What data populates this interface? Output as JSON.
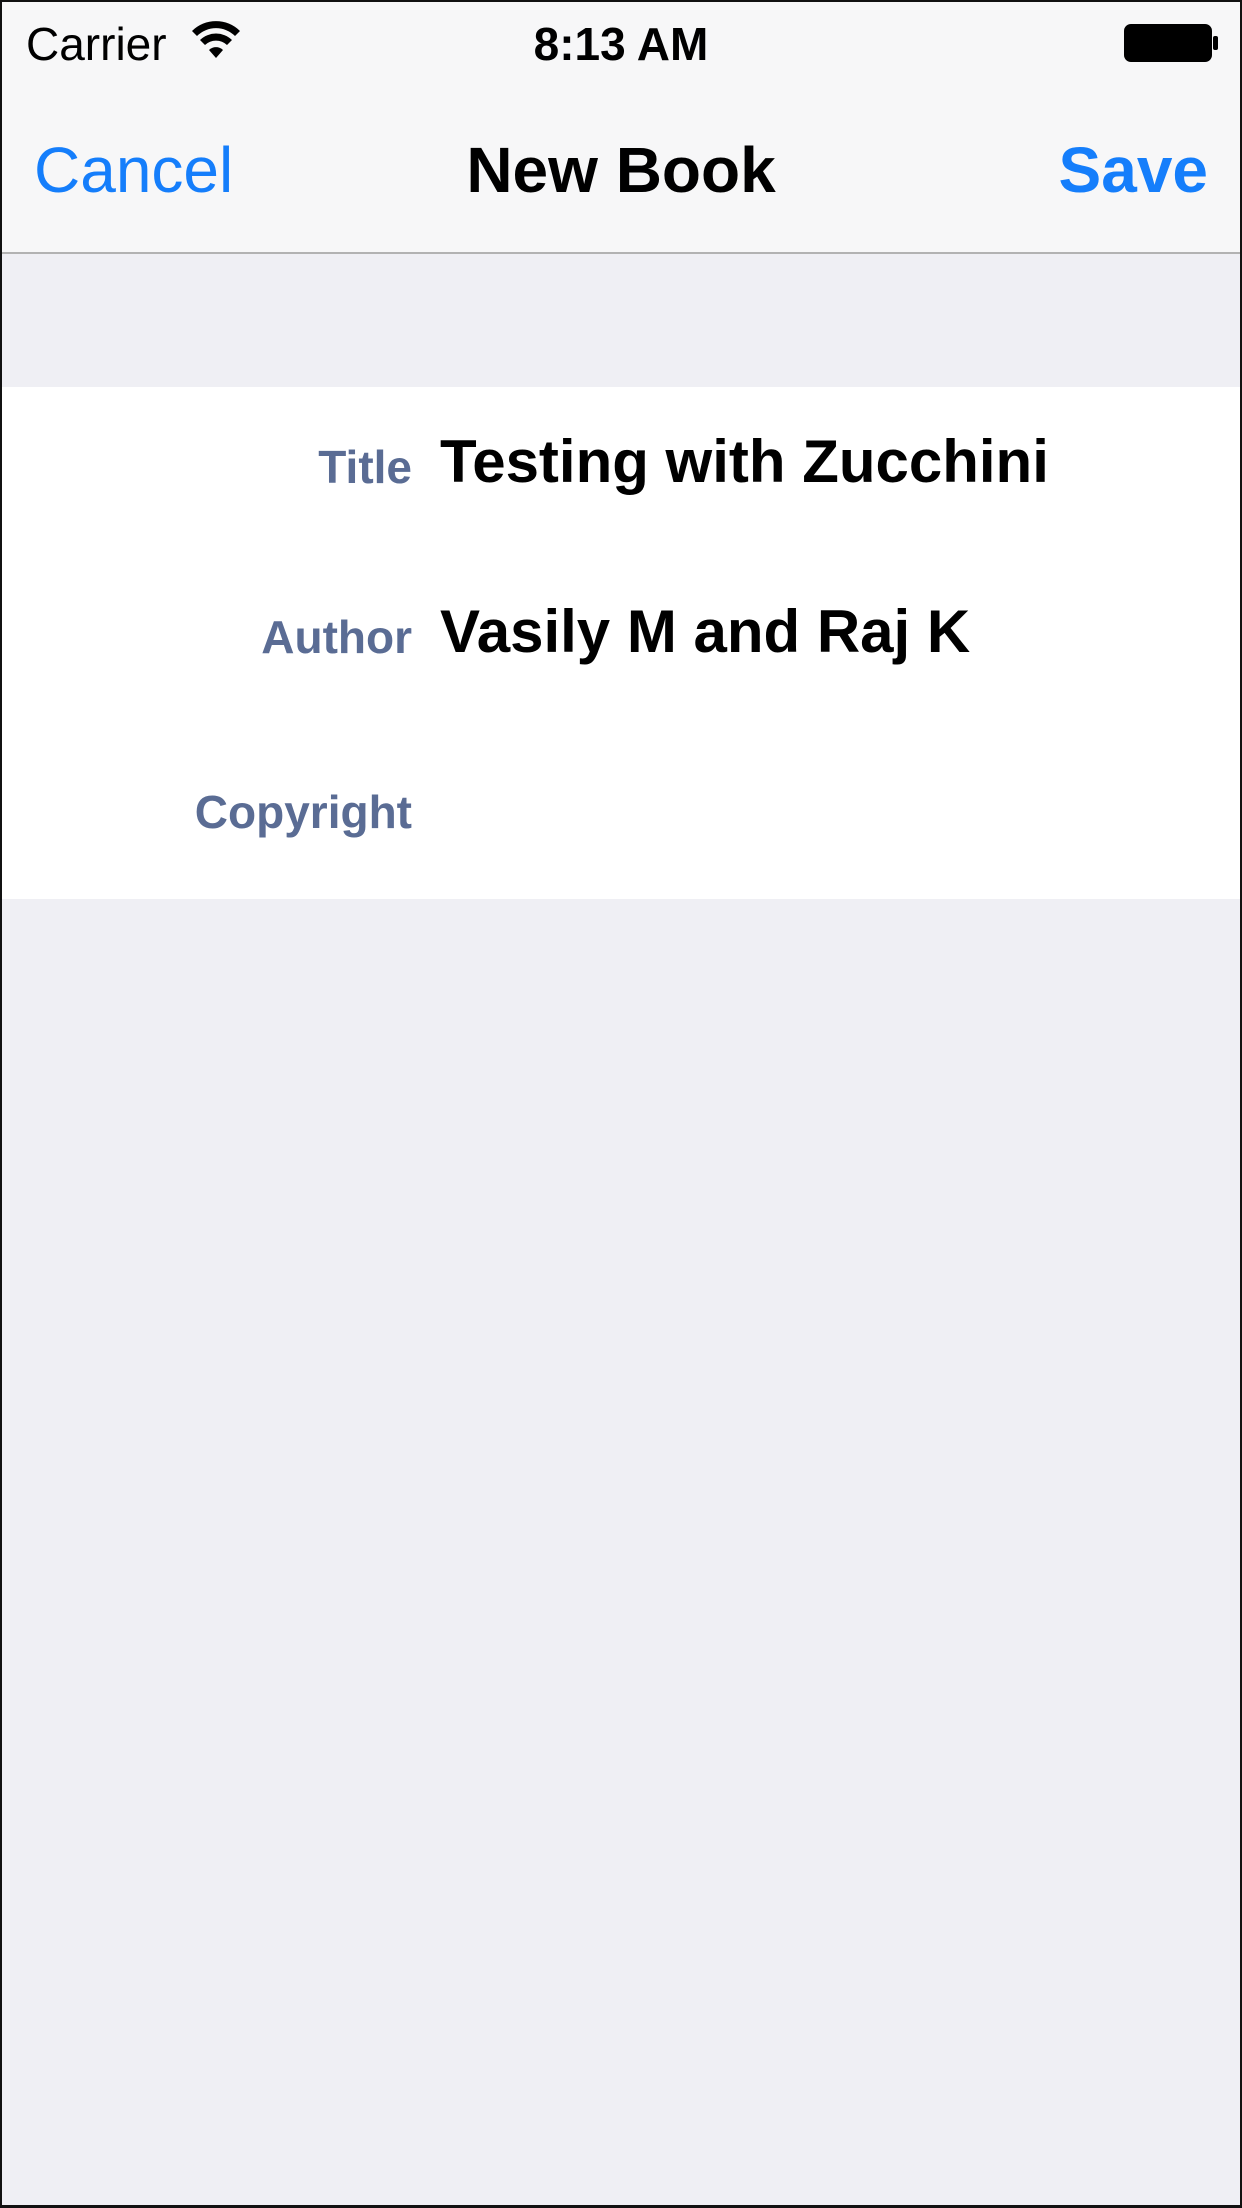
{
  "status_bar": {
    "carrier": "Carrier",
    "time": "8:13 AM",
    "wifi_icon": "wifi-icon",
    "battery_icon": "battery-icon"
  },
  "nav_bar": {
    "cancel_label": "Cancel",
    "title": "New Book",
    "save_label": "Save"
  },
  "form": {
    "fields": [
      {
        "label": "Title",
        "value": "Testing with Zucchini"
      },
      {
        "label": "Author",
        "value": "Vasily M and Raj K"
      },
      {
        "label": "Copyright",
        "value": ""
      }
    ]
  },
  "colors": {
    "accent": "#157efb",
    "label": "#5a6c94",
    "background": "#efeff4",
    "bar_background": "#f7f7f8",
    "section_background": "#ffffff"
  }
}
